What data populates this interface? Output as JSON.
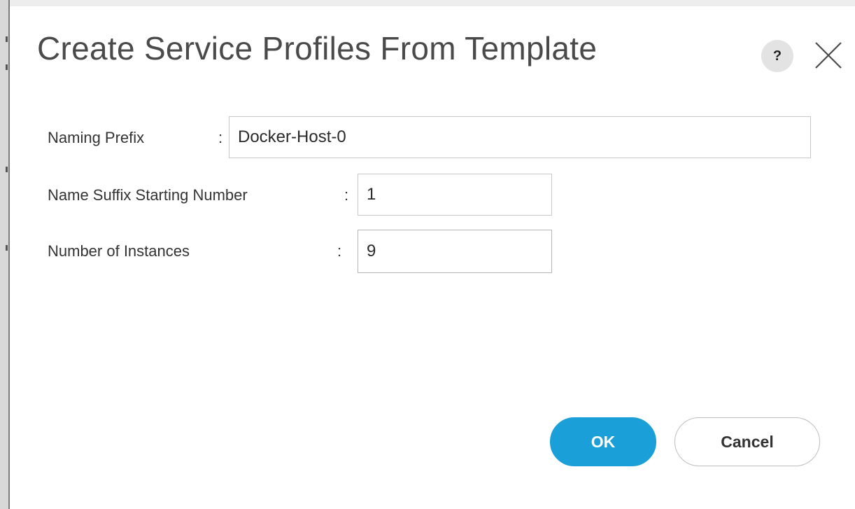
{
  "dialog": {
    "title": "Create Service Profiles From Template",
    "help_label": "?"
  },
  "form": {
    "naming_prefix": {
      "label": "Naming Prefix",
      "value": "Docker-Host-0"
    },
    "suffix_start": {
      "label": "Name Suffix Starting Number",
      "value": "1"
    },
    "instances": {
      "label": "Number of Instances",
      "value": "9"
    },
    "separator": ":"
  },
  "actions": {
    "ok_label": "OK",
    "cancel_label": "Cancel"
  },
  "colors": {
    "primary": "#1a9fd8",
    "title_text": "#4a4a4a",
    "label_text": "#333333",
    "input_border": "#c9c9c9"
  },
  "icons": {
    "help": "help-icon",
    "close": "close-icon"
  }
}
